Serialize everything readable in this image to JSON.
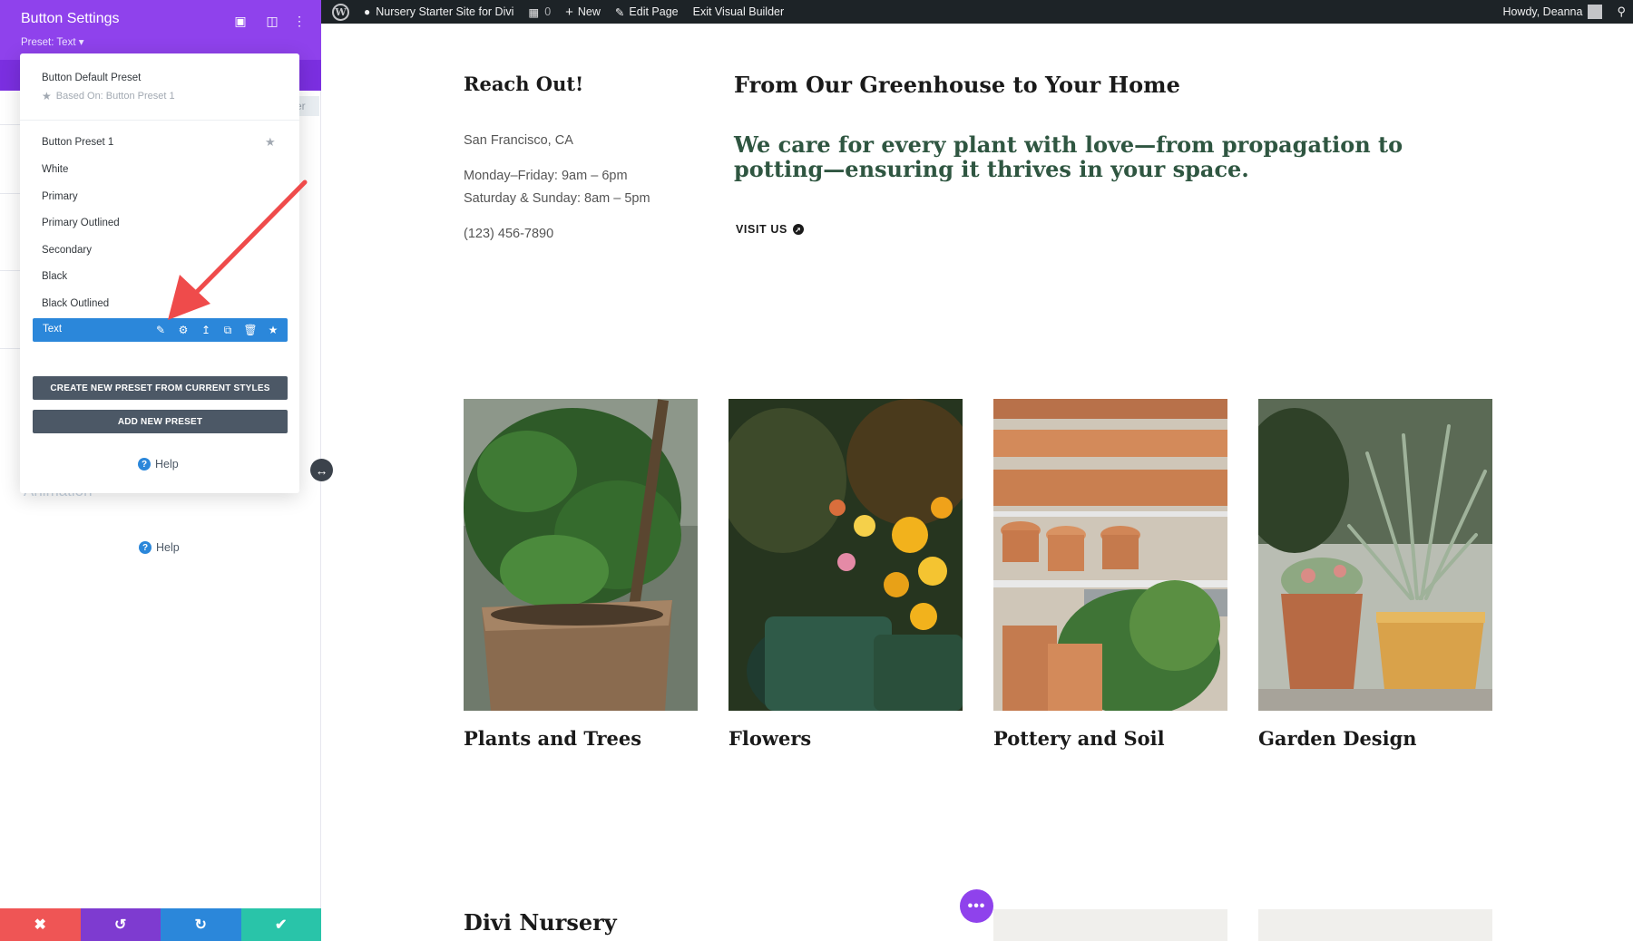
{
  "admin_bar": {
    "site_name": "Nursery Starter Site for Divi",
    "comments_count": "0",
    "new_label": "New",
    "edit_page_label": "Edit Page",
    "exit_builder_label": "Exit Visual Builder",
    "greeting": "Howdy, Deanna"
  },
  "sidebar": {
    "title": "Button Settings",
    "preset_label": "Preset: Text ▾",
    "ghost_tab_text": "er",
    "ghost_section_text": "Animation",
    "help_label": "Help"
  },
  "preset_dropdown": {
    "default_preset": "Button Default Preset",
    "based_on": "Based On: Button Preset 1",
    "presets": [
      "Button Preset 1",
      "White",
      "Primary",
      "Primary Outlined",
      "Secondary",
      "Black",
      "Black Outlined"
    ],
    "active_preset": "Text",
    "create_button": "CREATE NEW PRESET FROM CURRENT STYLES",
    "add_button": "ADD NEW PRESET",
    "help_label": "Help"
  },
  "page": {
    "reach_out_title": "Reach Out!",
    "location": "San Francisco, CA",
    "hours_weekday": "Monday–Friday: 9am – 6pm",
    "hours_weekend": "Saturday & Sunday: 8am – 5pm",
    "phone": "(123) 456-7890",
    "greenhouse_title": "From Our Greenhouse to Your Home",
    "greenhouse_text": "We care for every plant with love—from propagation to potting—ensuring it thrives in your space.",
    "visit_us": "VISIT US",
    "cards": [
      "Plants and Trees",
      "Flowers",
      "Pottery and Soil",
      "Garden Design"
    ],
    "nursery_title": "Divi Nursery"
  },
  "colors": {
    "divi_purple": "#8f42ec",
    "active_blue": "#2b87da",
    "heading_green": "#2f5641",
    "cancel_red": "#ef5555",
    "save_green": "#29c4a9"
  }
}
